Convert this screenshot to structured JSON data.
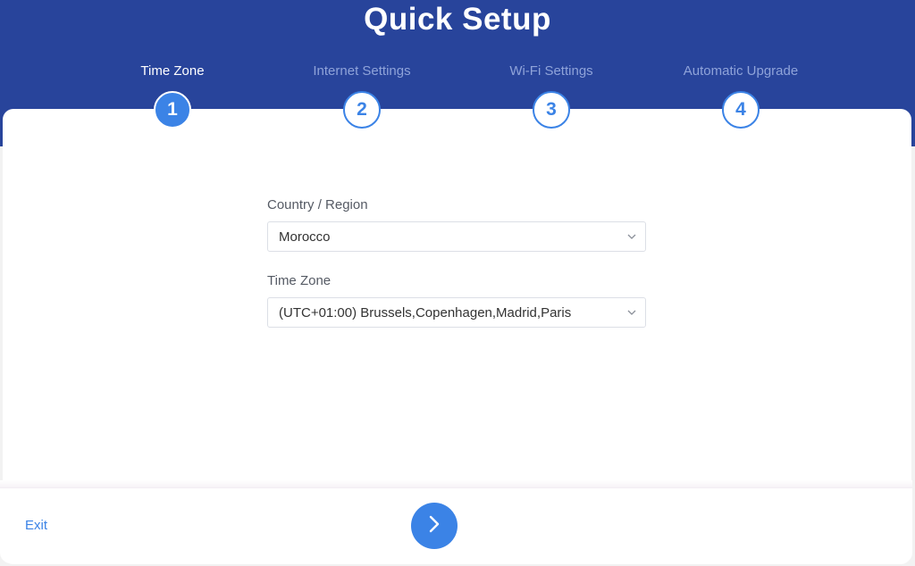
{
  "header": {
    "title": "Quick Setup"
  },
  "steps": [
    {
      "number": "1",
      "label": "Time Zone",
      "active": true
    },
    {
      "number": "2",
      "label": "Internet Settings",
      "active": false
    },
    {
      "number": "3",
      "label": "Wi-Fi Settings",
      "active": false
    },
    {
      "number": "4",
      "label": "Automatic Upgrade",
      "active": false
    }
  ],
  "form": {
    "country": {
      "label": "Country / Region",
      "value": "Morocco"
    },
    "timezone": {
      "label": "Time Zone",
      "value": "(UTC+01:00) Brussels,Copenhagen,Madrid,Paris"
    }
  },
  "footer": {
    "exit_label": "Exit",
    "next_icon": "chevron-right-icon"
  },
  "colors": {
    "header_bg": "#28449b",
    "accent": "#3b83e6",
    "inactive_step_text": "#8fa3d9"
  }
}
